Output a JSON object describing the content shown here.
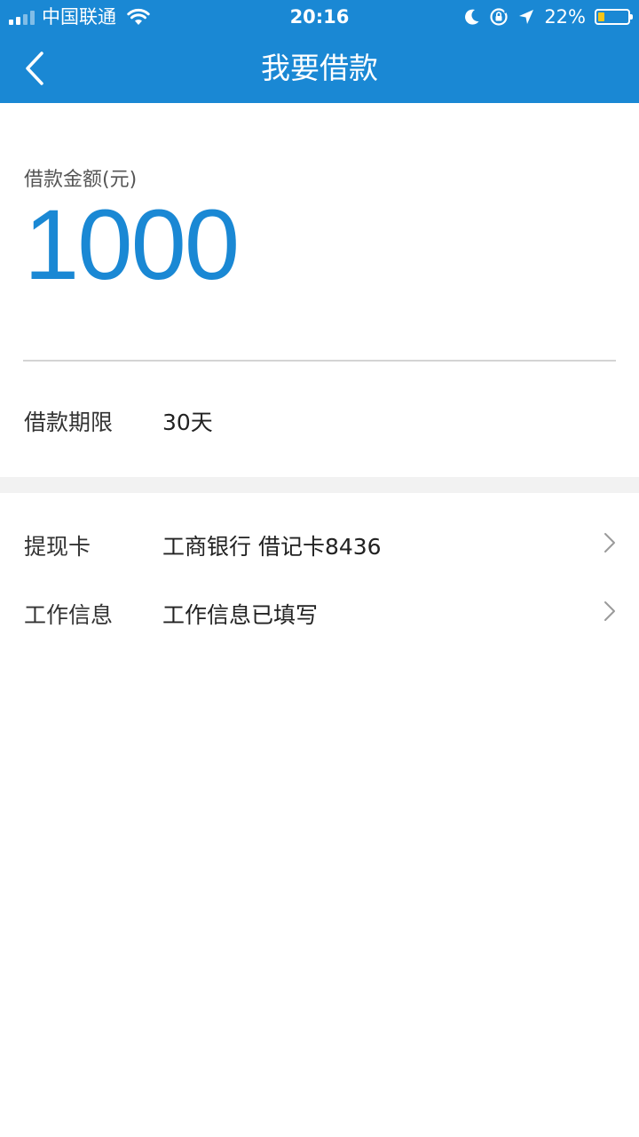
{
  "status_bar": {
    "carrier": "中国联通",
    "time": "20:16",
    "battery_percent": "22%",
    "battery_level": 0.22,
    "battery_color": "#f5c518"
  },
  "nav": {
    "title": "我要借款",
    "back_icon": "chevron-left-icon"
  },
  "amount": {
    "label": "借款金额(元)",
    "value": "1000"
  },
  "term": {
    "label": "借款期限",
    "value": "30天"
  },
  "list": {
    "items": [
      {
        "label": "提现卡",
        "value": "工商银行 借记卡8436",
        "icon": "chevron-right-icon"
      },
      {
        "label": "工作信息",
        "value": "工作信息已填写",
        "icon": "chevron-right-icon"
      }
    ]
  },
  "colors": {
    "primary": "#1a88d4",
    "divider": "#d4d4d4",
    "section_gap": "#f2f2f2"
  }
}
